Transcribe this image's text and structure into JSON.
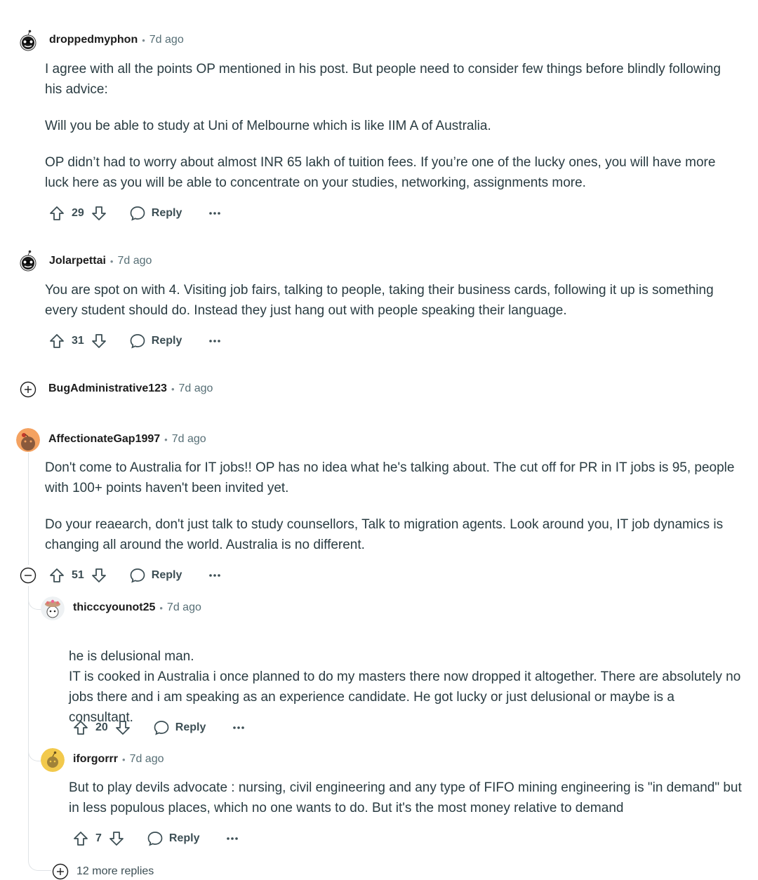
{
  "comments": [
    {
      "username": "droppedmyphon",
      "time": "7d ago",
      "paragraphs": [
        "I agree with all the points OP mentioned in his post. But people need to consider few things before blindly following his advice:",
        "Will you be able to study at Uni of Melbourne which is like IIM A of Australia.",
        "OP didn’t had to worry about almost INR 65 lakh of tuition fees. If you’re one of the lucky ones, you will have more luck here as you will be able to concentrate on your studies, networking, assignments more."
      ],
      "votes": "29",
      "reply_label": "Reply",
      "avatar_icon": "snoo-sunglasses-avatar"
    },
    {
      "username": "Jolarpettai",
      "time": "7d ago",
      "paragraphs": [
        "You are spot on with 4. Visiting job fairs, talking to people, taking their business cards, following it up is something every student should do. Instead they just hang out with people speaking their language."
      ],
      "votes": "31",
      "reply_label": "Reply",
      "avatar_icon": "snoo-sunglasses-avatar"
    },
    {
      "username": "BugAdministrative123",
      "time": "7d ago",
      "collapsed": true
    },
    {
      "username": "AffectionateGap1997",
      "time": "7d ago",
      "paragraphs": [
        "Don't come to Australia for IT jobs!! OP has no idea what he's talking about. The cut off for PR in IT jobs is 95, people with 100+ points haven't been invited yet.",
        "Do your reaearch, don't just talk to study counsellors, Talk to migration agents. Look around you, IT job dynamics is changing all around the world. Australia is no different."
      ],
      "votes": "51",
      "reply_label": "Reply",
      "avatar_icon": "snoo-orange-avatar"
    }
  ],
  "replies": [
    {
      "username": "thicccyounot25",
      "time": "7d ago",
      "paragraphs": [
        "he is delusional man.\nIT is cooked in Australia i once planned to do my masters there now dropped it altogether. There are absolutely no jobs there and i am speaking as an experience candidate. He got lucky or just delusional or maybe is a consultant."
      ],
      "votes": "20",
      "reply_label": "Reply",
      "avatar_icon": "snoo-flower-hat-avatar"
    },
    {
      "username": "iforgorrr",
      "time": "7d ago",
      "paragraphs": [
        "But to play devils advocate : nursing, civil engineering and any type of FIFO mining engineering is \"in demand\" but in less populous places, which no one wants to do. But it's the most money relative to demand"
      ],
      "votes": "7",
      "reply_label": "Reply",
      "avatar_icon": "snoo-yellow-avatar"
    }
  ],
  "more_replies": "12 more replies",
  "meta_separator": "•",
  "colors": {
    "text": "#2a3c42",
    "muted": "#576f76",
    "thread_line": "#dfe3e6",
    "orange_avatar": "#f4a261",
    "yellow_avatar": "#f2c94c"
  }
}
